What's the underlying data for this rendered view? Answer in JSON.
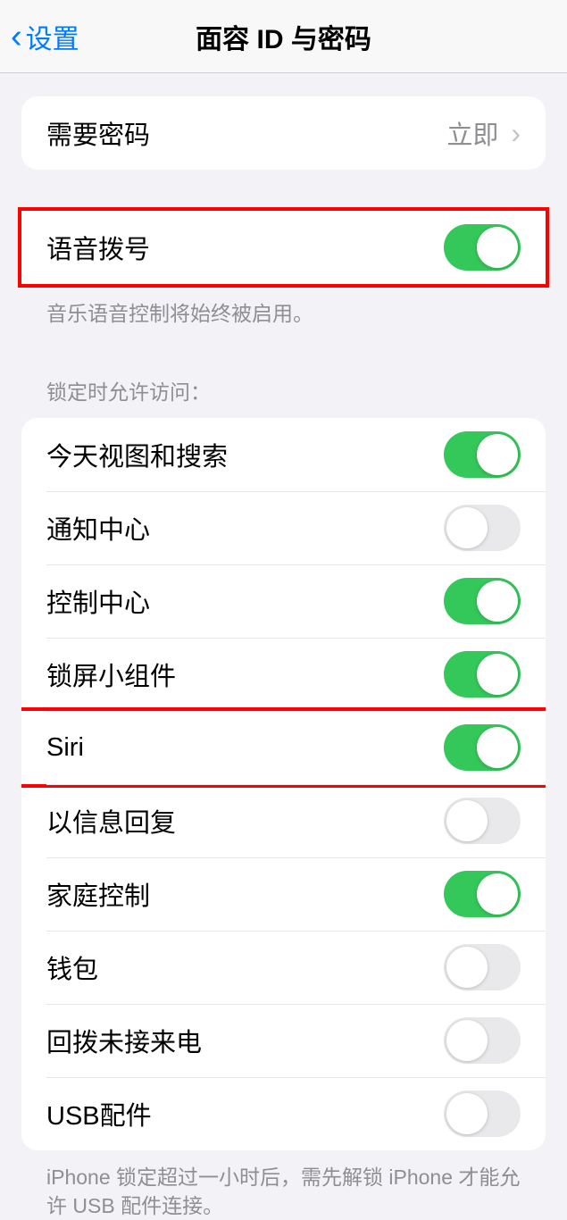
{
  "header": {
    "back": "设置",
    "title": "面容 ID 与密码"
  },
  "requirePasscode": {
    "label": "需要密码",
    "value": "立即"
  },
  "voiceDial": {
    "label": "语音拨号",
    "on": true,
    "footer": "音乐语音控制将始终被启用。"
  },
  "lockedAccess": {
    "header": "锁定时允许访问：",
    "items": [
      {
        "label": "今天视图和搜索",
        "on": true,
        "name": "today-view-toggle",
        "highlight": false
      },
      {
        "label": "通知中心",
        "on": false,
        "name": "notification-center-toggle",
        "highlight": false
      },
      {
        "label": "控制中心",
        "on": true,
        "name": "control-center-toggle",
        "highlight": false
      },
      {
        "label": "锁屏小组件",
        "on": true,
        "name": "lock-screen-widgets-toggle",
        "highlight": false
      },
      {
        "label": "Siri",
        "on": true,
        "name": "siri-toggle",
        "highlight": true
      },
      {
        "label": "以信息回复",
        "on": false,
        "name": "reply-with-message-toggle",
        "highlight": false
      },
      {
        "label": "家庭控制",
        "on": true,
        "name": "home-control-toggle",
        "highlight": false
      },
      {
        "label": "钱包",
        "on": false,
        "name": "wallet-toggle",
        "highlight": false
      },
      {
        "label": "回拨未接来电",
        "on": false,
        "name": "return-missed-calls-toggle",
        "highlight": false
      },
      {
        "label": "USB配件",
        "on": false,
        "name": "usb-accessories-toggle",
        "highlight": false
      }
    ],
    "footer": "iPhone 锁定超过一小时后，需先解锁 iPhone 才能允许 USB 配件连接。"
  }
}
